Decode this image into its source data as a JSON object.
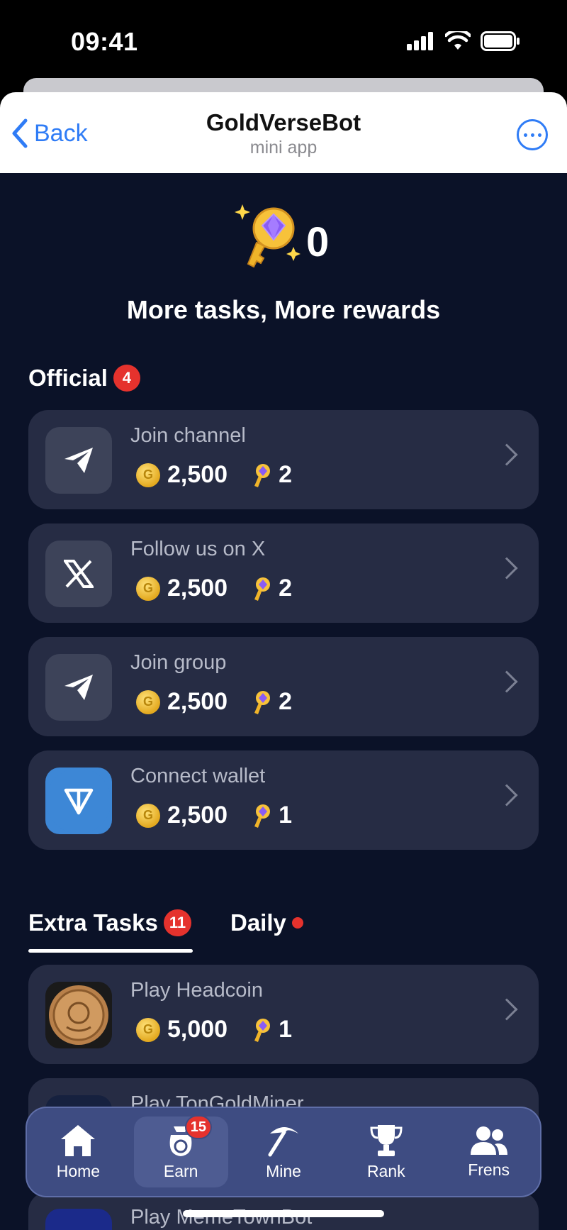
{
  "status_bar": {
    "time": "09:41"
  },
  "header": {
    "back_label": "Back",
    "title": "GoldVerseBot",
    "subtitle": "mini app"
  },
  "hero": {
    "key_count": "0",
    "headline": "More tasks, More rewards"
  },
  "official": {
    "title": "Official",
    "badge": "4",
    "tasks": [
      {
        "name": "Join channel",
        "coins": "2,500",
        "keys": "2",
        "icon": "telegram-plane-icon"
      },
      {
        "name": "Follow us on X",
        "coins": "2,500",
        "keys": "2",
        "icon": "x-logo-icon"
      },
      {
        "name": "Join group",
        "coins": "2,500",
        "keys": "2",
        "icon": "telegram-plane-icon"
      },
      {
        "name": "Connect wallet",
        "coins": "2,500",
        "keys": "1",
        "icon": "ton-logo-icon"
      }
    ]
  },
  "tabs": {
    "extra_label": "Extra Tasks",
    "extra_badge": "11",
    "daily_label": "Daily"
  },
  "extra_tasks": [
    {
      "name": "Play Headcoin",
      "coins": "5,000",
      "keys": "1",
      "icon": "headcoin-icon"
    },
    {
      "name": "Play TonGoldMiner"
    },
    {
      "name": "Play MemeTownBot"
    }
  ],
  "bottom_nav": {
    "items": [
      {
        "label": "Home",
        "icon": "home-icon"
      },
      {
        "label": "Earn",
        "icon": "coin-bag-icon",
        "badge": "15",
        "active": true
      },
      {
        "label": "Mine",
        "icon": "pickaxe-icon"
      },
      {
        "label": "Rank",
        "icon": "trophy-icon"
      },
      {
        "label": "Frens",
        "icon": "friends-icon"
      }
    ]
  },
  "colors": {
    "background": "#0b1228",
    "card": "#262c44",
    "accent_red": "#e5322d",
    "link_blue": "#2f7cf6",
    "nav": "#3e4c82"
  }
}
